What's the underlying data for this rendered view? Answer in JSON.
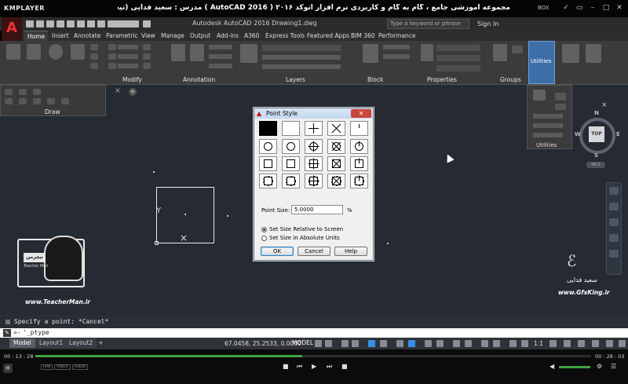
{
  "player": {
    "brand": "KMPLAYER",
    "title": "مجموعه آموزشی جامع ، گام به گام و کاربردی نرم افزار اتوکد ۲۰۱۶ ( AutoCAD 2016 ) مدرس : سعید فدایی (تیچرمن) گروه آموزشی پادشاه گرافیست ها",
    "box_label": "BOX",
    "time_elapsed": "00 : 13 : 28",
    "time_total": "00 : 28 : 03",
    "progress": 0.48,
    "badges": [
      "H/W",
      "VIDEO",
      "AUDIO"
    ]
  },
  "acad": {
    "logo": "A",
    "title": "Autodesk AutoCAD 2016    Drawing1.dwg",
    "search_placeholder": "Type a keyword or phrase",
    "signin": "Sign In",
    "tabs": [
      "Home",
      "Insert",
      "Annotate",
      "Parametric",
      "View",
      "Manage",
      "Output",
      "Add-ins",
      "A360",
      "Express Tools",
      "Featured Apps",
      "BIM 360",
      "Performance"
    ],
    "panels": [
      "Draw",
      "Modify",
      "Annotation",
      "Layers",
      "Block",
      "Properties",
      "Groups",
      "Utilities"
    ],
    "utilities_label": "Utilities",
    "utilities_panel_label": "Utilities"
  },
  "drawing": {
    "file_tab_close": "×",
    "file_tab_plus": "+",
    "compass": {
      "n": "N",
      "s": "S",
      "e": "E",
      "w": "W"
    },
    "viewcube_top": "TOP",
    "wcs": "WCS",
    "rect_y_label": "Y",
    "rect_x_mark": "×"
  },
  "dialog": {
    "title": "Point Style",
    "close": "✕",
    "point_size_label": "Point Size:",
    "point_size_value": "5.0000",
    "point_size_unit": "%",
    "radio_relative": "Set Size Relative to Screen",
    "radio_absolute": "Set Size in Absolute Units",
    "relative_selected": true,
    "ok": "OK",
    "cancel": "Cancel",
    "help": "Help",
    "selected_style": 0
  },
  "watermarks": {
    "teacher_name": "تیچرمن",
    "teacher_sub": "Teacher Man",
    "teacher_url": "www.TeacherMan.ir",
    "gfx_name": "سعید فدایی",
    "gfx_url": "www.GfxKing.ir"
  },
  "command": {
    "history": "Specify a point: *Cancel*",
    "prompt": "»-",
    "input": "'_ptype"
  },
  "status": {
    "tabs": [
      "Model",
      "Layout1",
      "Layout2"
    ],
    "add_tab": "+",
    "coords": "67.0458, 25.2533, 0.0000",
    "mode": "MODEL",
    "scale": "1:1"
  }
}
